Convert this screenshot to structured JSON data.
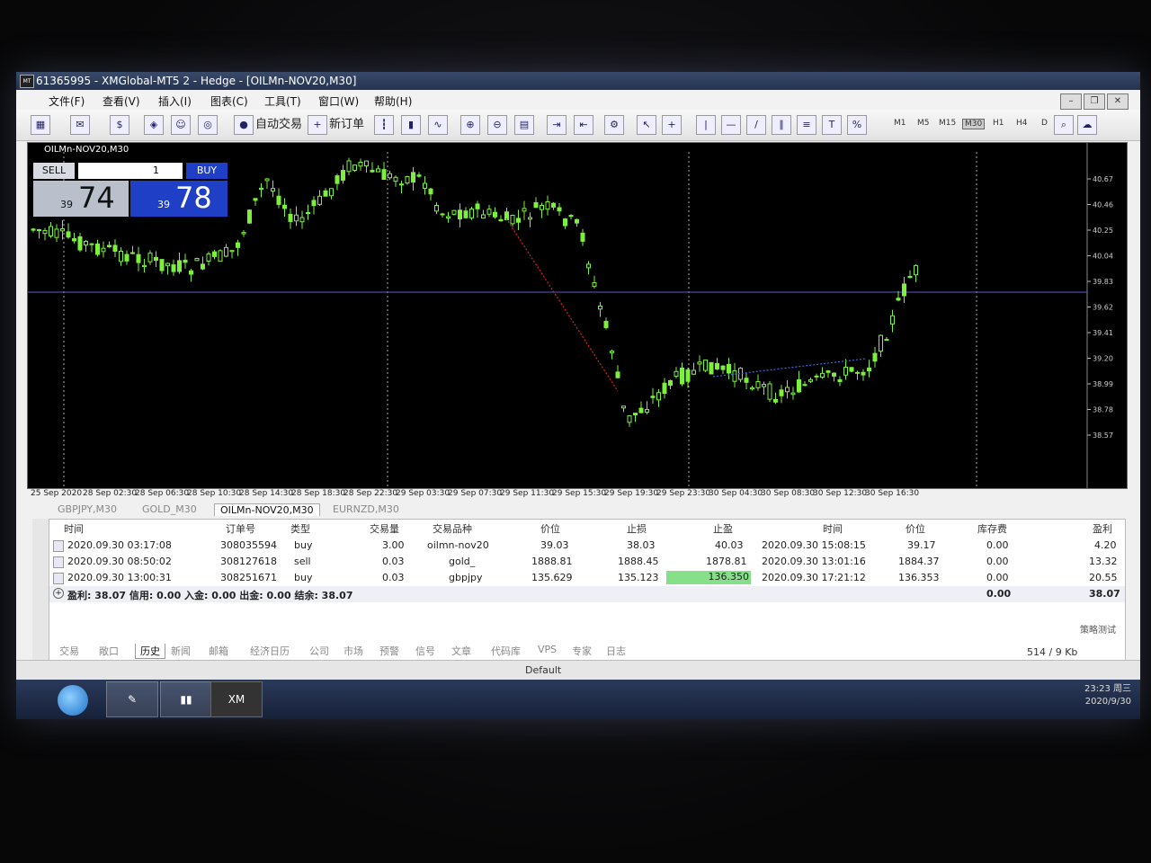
{
  "window": {
    "title": "61365995 - XMGlobal-MT5 2 - Hedge - [OILMn-NOV20,M30]"
  },
  "menu": [
    "文件(F)",
    "查看(V)",
    "插入(I)",
    "图表(C)",
    "工具(T)",
    "窗口(W)",
    "帮助(H)"
  ],
  "toolbar": {
    "autotrade_label": "自动交易",
    "neworder_label": "新订单",
    "timeframes": [
      "M1",
      "M5",
      "M15",
      "M30",
      "H1",
      "H4",
      "D"
    ],
    "active_timeframe": "M30"
  },
  "chart": {
    "title": "OILMn-NOV20,M30",
    "sell_label": "SELL",
    "buy_label": "BUY",
    "lot": "1",
    "sell_small": "39",
    "sell_big": "74",
    "buy_small": "39",
    "buy_big": "78",
    "price_labels": [
      "40.67",
      "40.46",
      "40.25",
      "40.04",
      "39.83",
      "39.62",
      "39.41",
      "39.20",
      "38.99",
      "38.78",
      "38.57"
    ],
    "time_labels": [
      "25 Sep 2020",
      "28 Sep 02:30",
      "28 Sep 06:30",
      "28 Sep 10:30",
      "28 Sep 14:30",
      "28 Sep 18:30",
      "28 Sep 22:30",
      "29 Sep 03:30",
      "29 Sep 07:30",
      "29 Sep 11:30",
      "29 Sep 15:30",
      "29 Sep 19:30",
      "29 Sep 23:30",
      "30 Sep 04:30",
      "30 Sep 08:30",
      "30 Sep 12:30",
      "30 Sep 16:30"
    ],
    "colors": {
      "bull": "#7cf03c",
      "bear": "#7cf03c",
      "bg": "#000000",
      "line": "#5a5acc"
    }
  },
  "symbol_tabs": [
    "GBPJPY,M30",
    "GOLD_M30",
    "OILMn-NOV20,M30",
    "EURNZD,M30"
  ],
  "active_symbol_tab": "OILMn-NOV20,M30",
  "positions": {
    "headers": [
      "时间",
      "订单号",
      "类型",
      "交易量",
      "交易品种",
      "价位",
      "止损",
      "止盈",
      "时间",
      "价位",
      "库存费",
      "盈利"
    ],
    "rows": [
      [
        "2020.09.30 03:17:08",
        "308035594",
        "buy",
        "3.00",
        "oilmn-nov20",
        "39.03",
        "38.03",
        "40.03",
        "2020.09.30 15:08:15",
        "39.17",
        "0.00",
        "4.20"
      ],
      [
        "2020.09.30 08:50:02",
        "308127618",
        "sell",
        "0.03",
        "gold_",
        "1888.81",
        "1888.45",
        "1878.81",
        "2020.09.30 13:01:16",
        "1884.37",
        "0.00",
        "13.32"
      ],
      [
        "2020.09.30 13:00:31",
        "308251671",
        "buy",
        "0.03",
        "gbpjpy",
        "135.629",
        "135.123",
        "136.350",
        "2020.09.30 17:21:12",
        "136.353",
        "0.00",
        "20.55"
      ]
    ],
    "total_swap": "0.00",
    "total_profit": "38.07",
    "summary": "盈利: 38.07  信用: 0.00  入金: 0.00  出金: 0.00  结余: 38.07"
  },
  "bottom_tabs": [
    "交易",
    "敞口",
    "历史",
    "新闻",
    "邮箱",
    "经济日历",
    "公司",
    "市场",
    "预警",
    "信号",
    "文章",
    "代码库",
    "VPS",
    "专家",
    "日志"
  ],
  "active_bottom_tab": "历史",
  "strategy_tester": "策略测试",
  "status": {
    "profile": "Default",
    "traffic": "514 / 9 Kb",
    "time": "23:23 周三",
    "date": "2020/9/30"
  },
  "taskbar": {
    "xm_label": "XM"
  }
}
